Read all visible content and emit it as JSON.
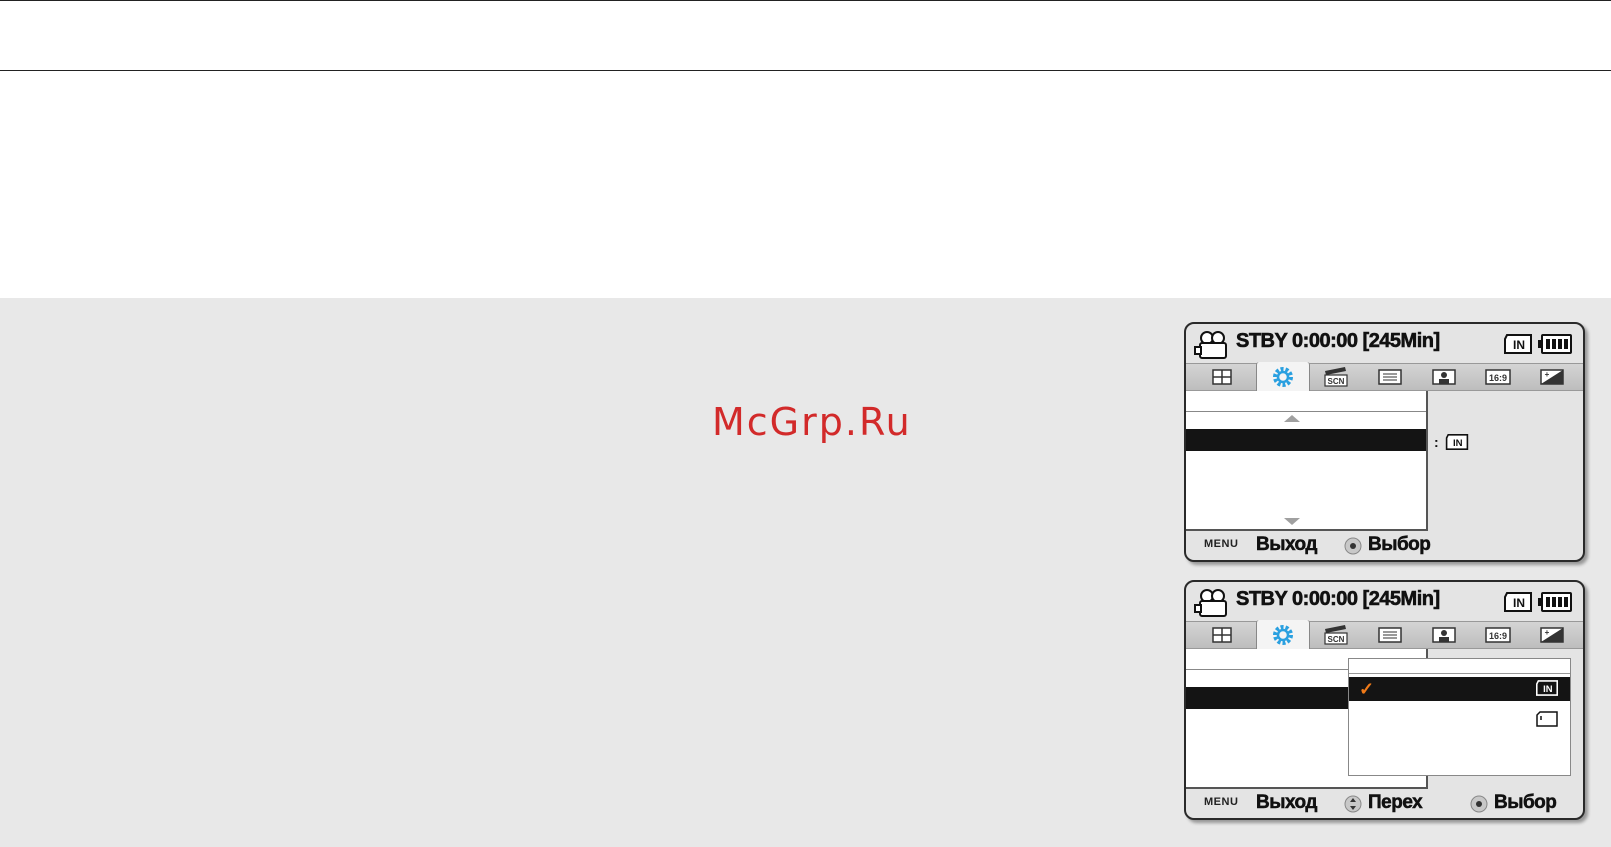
{
  "watermark": "McGrp.Ru",
  "screens": [
    {
      "status": "STBY 0:00:00 [245Min]",
      "tabs": [
        {
          "icon": "grid-icon"
        },
        {
          "icon": "gear-icon",
          "active": true
        },
        {
          "icon": "scene-icon",
          "label": "SCN"
        },
        {
          "icon": "quality-icon"
        },
        {
          "icon": "portrait-icon"
        },
        {
          "icon": "aspect-icon",
          "label": "16:9"
        },
        {
          "icon": "exposure-icon"
        }
      ],
      "side_value_colon": ":",
      "storage_in_label": "IN",
      "footer": {
        "menu_label": "MENU",
        "exit_label": "Выход",
        "select_label": "Выбор"
      }
    },
    {
      "status": "STBY 0:00:00 [245Min]",
      "tabs": [
        {
          "icon": "grid-icon"
        },
        {
          "icon": "gear-icon",
          "active": true
        },
        {
          "icon": "scene-icon",
          "label": "SCN"
        },
        {
          "icon": "quality-icon"
        },
        {
          "icon": "portrait-icon"
        },
        {
          "icon": "aspect-icon",
          "label": "16:9"
        },
        {
          "icon": "exposure-icon"
        }
      ],
      "popup": {
        "check_mark": "✓",
        "options": [
          {
            "icon": "internal-memory-icon",
            "label": "IN",
            "selected": true
          },
          {
            "icon": "memory-card-icon"
          }
        ]
      },
      "footer": {
        "menu_label": "MENU",
        "exit_label": "Выход",
        "move_label": "Перех",
        "select_label": "Выбор"
      }
    }
  ],
  "colors": {
    "accent_check": "#f07a18",
    "gear_blue": "#2aa0e0",
    "watermark_red": "#d22a2a",
    "selection": "#141414"
  }
}
